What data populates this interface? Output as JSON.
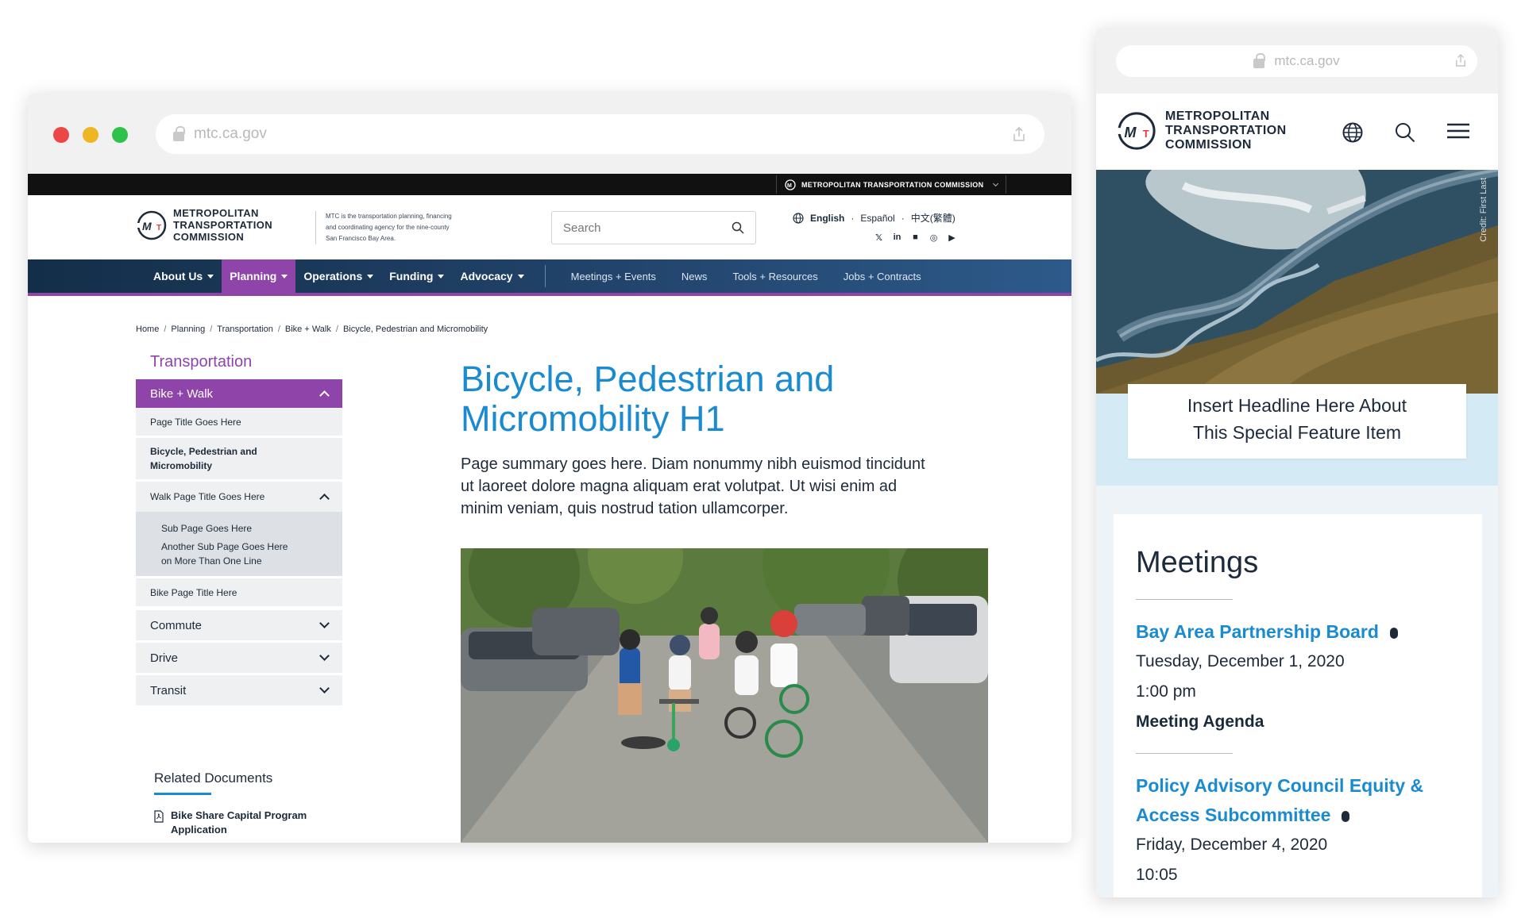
{
  "desktop": {
    "url": "mtc.ca.gov",
    "topbar_label": "METROPOLITAN TRANSPORTATION COMMISSION",
    "logo_lines": [
      "METROPOLITAN",
      "TRANSPORTATION",
      "COMMISSION"
    ],
    "tagline": "MTC is the transportation planning, financing and coordinating agency for the nine-county San Francisco Bay Area.",
    "search_placeholder": "Search",
    "languages": {
      "english": "English",
      "espanol": "Español",
      "chinese": "中文(繁體)"
    },
    "social_icons": [
      "twitter-icon",
      "linkedin-icon",
      "facebook-icon",
      "instagram-icon",
      "youtube-icon"
    ],
    "nav_primary": [
      "About Us",
      "Planning",
      "Operations",
      "Funding",
      "Advocacy"
    ],
    "nav_secondary": [
      "Meetings + Events",
      "News",
      "Tools + Resources",
      "Jobs + Contracts"
    ],
    "breadcrumb": [
      "Home",
      "Planning",
      "Transportation",
      "Bike + Walk",
      "Bicycle, Pedestrian and Micromobility"
    ],
    "sidebar": {
      "title": "Transportation",
      "open_section": "Bike + Walk",
      "pages": [
        "Page Title Goes Here",
        "Bicycle, Pedestrian and Micromobility",
        "Walk Page Title Goes Here"
      ],
      "subpages": [
        "Sub Page Goes Here",
        "Another Sub Page Goes Here on More Than One Line"
      ],
      "last_page": "Bike Page Title Here",
      "collapsed": [
        "Commute",
        "Drive",
        "Transit"
      ]
    },
    "related": {
      "heading": "Related Documents",
      "doc": "Bike Share Capital Program Application"
    },
    "h1": "Bicycle, Pedestrian and Micromobility H1",
    "summary": "Page summary goes here. Diam nonummy nibh euismod tincidunt ut laoreet dolore magna aliquam erat volutpat. Ut wisi enim ad minim veniam, quis nostrud tation ullamcorper."
  },
  "mobile": {
    "url": "mtc.ca.gov",
    "logo_lines": [
      "METROPOLITAN",
      "TRANSPORTATION",
      "COMMISSION"
    ],
    "credit": "Credit: First Last",
    "feature": "Insert Headline Here About This Special Feature Item",
    "meetings_title": "Meetings",
    "meetings": [
      {
        "title": "Bay Area Partnership Board",
        "date": "Tuesday, December 1, 2020",
        "time": "1:00 pm",
        "agenda": "Meeting Agenda"
      },
      {
        "title": "Policy Advisory Council Equity & Access Subcommittee",
        "date": "Friday, December 4, 2020",
        "time": "10:05"
      }
    ]
  },
  "colors": {
    "purple": "#8e44a9",
    "blue": "#1a8bd1",
    "navy": "#1d2a3a"
  }
}
